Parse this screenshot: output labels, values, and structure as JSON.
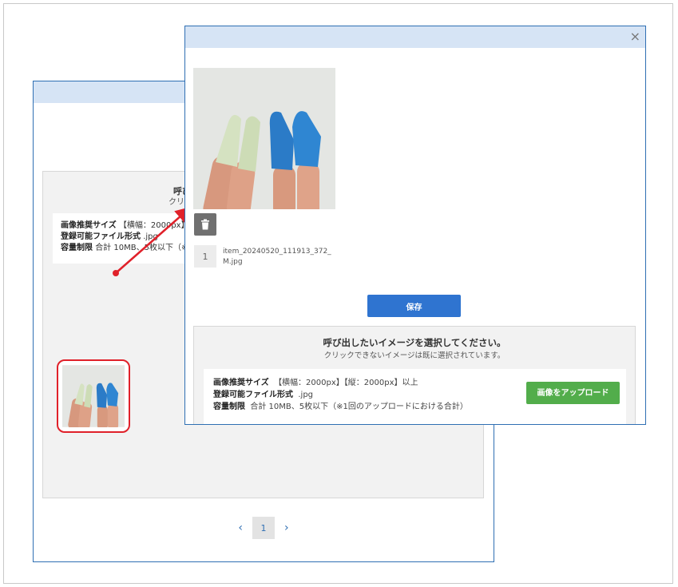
{
  "back_modal": {
    "title_partial": "呼び",
    "subtitle_partial": "クリック",
    "info": {
      "size_label": "画像推奨サイズ",
      "size_value": "【横幅：2000px】",
      "format_label": "登録可能ファイル形式",
      "format_value": ".jpg",
      "capacity_label": "容量制限",
      "capacity_value": "合計 10MB、5枚以下（※"
    },
    "pagination": {
      "prev_icon": "chevron-left-icon",
      "current_page": "1",
      "next_icon": "chevron-right-icon"
    }
  },
  "front_modal": {
    "close_label": "×",
    "image": {
      "order": "1",
      "filename": "item_20240520_111913_372_M.jpg"
    },
    "save_label": "保存",
    "select_panel": {
      "title": "呼び出したいイメージを選択してください。",
      "subtitle": "クリックできないイメージは既に選択されています。",
      "size_label": "画像推奨サイズ",
      "size_value": "【横幅：2000px】【縦：2000px】以上",
      "format_label": "登録可能ファイル形式",
      "format_value": ".jpg",
      "capacity_label": "容量制限",
      "capacity_value": "合計 10MB、5枚以下（※1回のアップロードにおける合計）",
      "upload_label": "画像をアップロード"
    }
  },
  "colors": {
    "header_bg": "#d6e4f5",
    "primary_blue": "#2f74d0",
    "upload_green": "#52ad4b",
    "highlight_red": "#e0212a"
  }
}
